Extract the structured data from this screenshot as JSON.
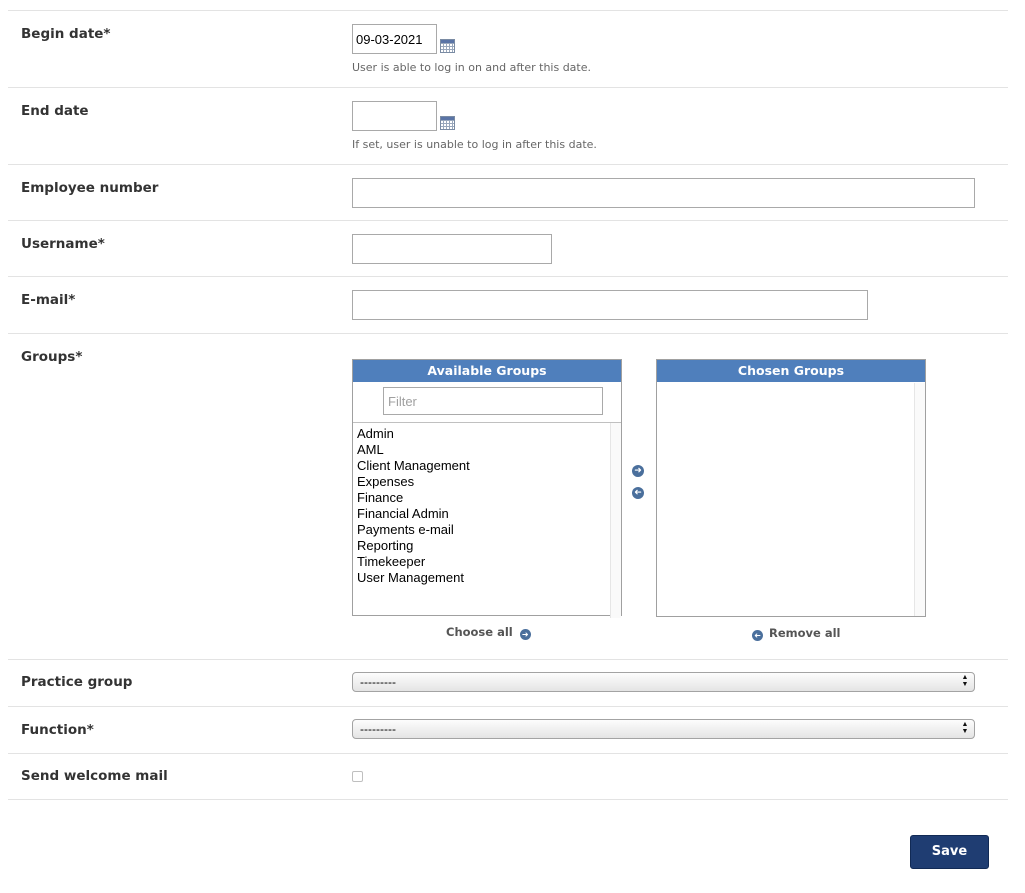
{
  "begin_date": {
    "label": "Begin date*",
    "value": "09-03-2021",
    "help": "User is able to log in on and after this date."
  },
  "end_date": {
    "label": "End date",
    "value": "",
    "help": "If set, user is unable to log in after this date."
  },
  "employee_number": {
    "label": "Employee number",
    "value": ""
  },
  "username": {
    "label": "Username*",
    "value": ""
  },
  "email": {
    "label": "E-mail*",
    "value": ""
  },
  "groups": {
    "label": "Groups*",
    "available_title": "Available Groups",
    "chosen_title": "Chosen Groups",
    "filter_placeholder": "Filter",
    "available": [
      "Admin",
      "AML",
      "Client Management",
      "Expenses",
      "Finance",
      "Financial Admin",
      "Payments e-mail",
      "Reporting",
      "Timekeeper",
      "User Management"
    ],
    "chosen": [],
    "choose_all": "Choose all",
    "remove_all": "Remove all"
  },
  "practice_group": {
    "label": "Practice group",
    "value": "---------"
  },
  "function": {
    "label": "Function*",
    "value": "---------"
  },
  "welcome_mail": {
    "label": "Send welcome mail",
    "checked": false
  },
  "save_label": "Save",
  "colors": {
    "selector_header": "#4f7fbc",
    "save_button": "#1f3d72",
    "arrow_icon": "#4a6f9c"
  }
}
